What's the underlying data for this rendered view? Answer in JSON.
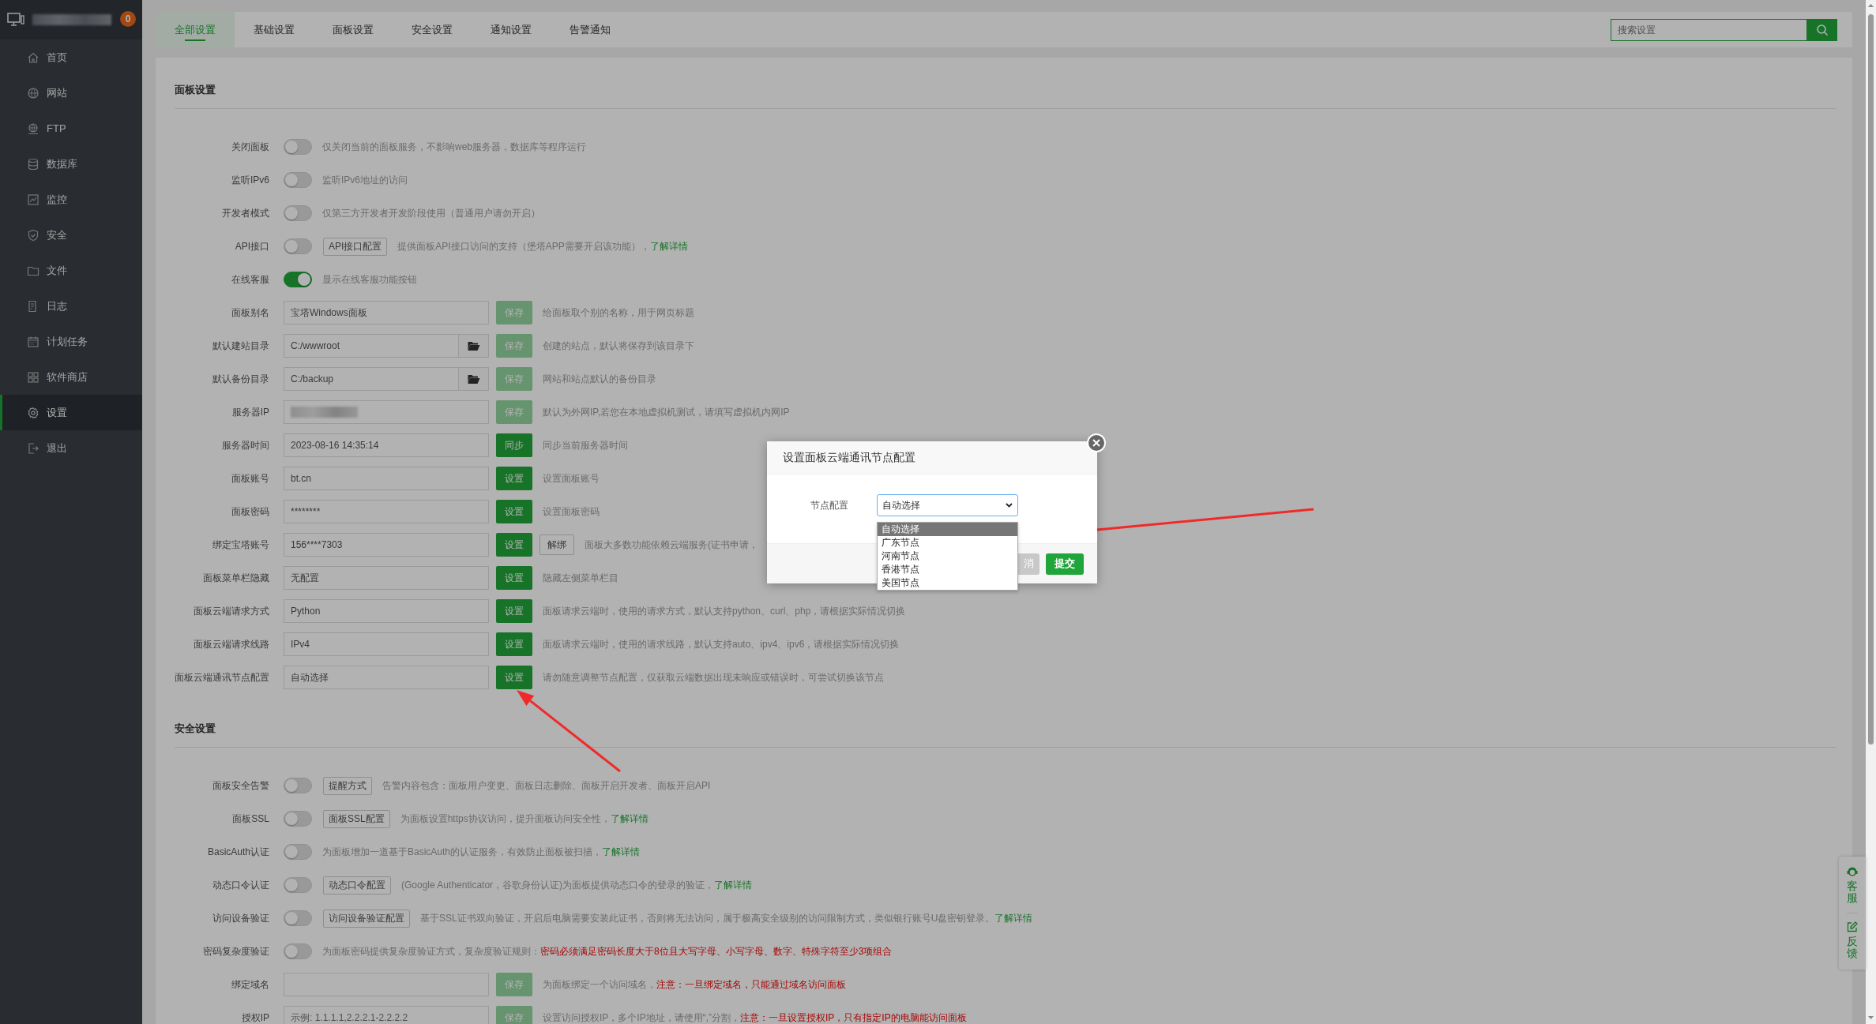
{
  "sidebar": {
    "title_redacted": true,
    "badge": "0",
    "items": [
      {
        "label": "首页",
        "selected": false
      },
      {
        "label": "网站",
        "selected": false
      },
      {
        "label": "FTP",
        "selected": false
      },
      {
        "label": "数据库",
        "selected": false
      },
      {
        "label": "监控",
        "selected": false
      },
      {
        "label": "安全",
        "selected": false
      },
      {
        "label": "文件",
        "selected": false
      },
      {
        "label": "日志",
        "selected": false
      },
      {
        "label": "计划任务",
        "selected": false
      },
      {
        "label": "软件商店",
        "selected": false
      },
      {
        "label": "设置",
        "selected": true
      },
      {
        "label": "退出",
        "selected": false
      }
    ]
  },
  "tabs": [
    {
      "label": "全部设置",
      "selected": true
    },
    {
      "label": "基础设置",
      "selected": false
    },
    {
      "label": "面板设置",
      "selected": false
    },
    {
      "label": "安全设置",
      "selected": false
    },
    {
      "label": "通知设置",
      "selected": false
    },
    {
      "label": "告警通知",
      "selected": false
    }
  ],
  "search": {
    "placeholder": "搜索设置"
  },
  "sections": [
    {
      "title": "面板设置",
      "rows": [
        {
          "kind": "toggle",
          "label": "关闭面板",
          "on": false,
          "description": [
            {
              "kind": "text",
              "text": "仅关闭当前的面板服务，不影响web服务器，数据库等程序运行"
            }
          ]
        },
        {
          "kind": "toggle",
          "label": "监听IPv6",
          "on": false,
          "description": [
            {
              "kind": "text",
              "text": "监听IPv6地址的访问"
            }
          ]
        },
        {
          "kind": "toggle",
          "label": "开发者模式",
          "on": false,
          "description": [
            {
              "kind": "text",
              "text": "仅第三方开发者开发阶段使用（普通用户请勿开启）"
            }
          ]
        },
        {
          "kind": "toggle",
          "label": "API接口",
          "on": false,
          "button": "API接口配置",
          "description": [
            {
              "kind": "text",
              "text": "提供面板API接口访问的支持（堡塔APP需要开启该功能），"
            },
            {
              "kind": "link",
              "text": "了解详情"
            }
          ]
        },
        {
          "kind": "toggle",
          "label": "在线客服",
          "on": true,
          "description": [
            {
              "kind": "text",
              "text": "显示在线客服功能按钮"
            }
          ]
        },
        {
          "kind": "input",
          "label": "面板别名",
          "value": "宝塔Windows面板",
          "action": {
            "label": "保存",
            "disabled": true
          },
          "description": [
            {
              "kind": "text",
              "text": "给面板取个别的名称，用于网页标题"
            }
          ]
        },
        {
          "kind": "input",
          "label": "默认建站目录",
          "value": "C:/wwwroot",
          "folder": true,
          "action": {
            "label": "保存",
            "disabled": true
          },
          "description": [
            {
              "kind": "text",
              "text": "创建的站点，默认将保存到该目录下"
            }
          ]
        },
        {
          "kind": "input",
          "label": "默认备份目录",
          "value": "C:/backup",
          "folder": true,
          "action": {
            "label": "保存",
            "disabled": true
          },
          "description": [
            {
              "kind": "text",
              "text": "网站和站点默认的备份目录"
            }
          ]
        },
        {
          "kind": "input",
          "label": "服务器IP",
          "redacted": true,
          "action": {
            "label": "保存",
            "disabled": true
          },
          "description": [
            {
              "kind": "text",
              "text": "默认为外网IP,若您在本地虚拟机测试，请填写虚拟机内网IP"
            }
          ]
        },
        {
          "kind": "input",
          "label": "服务器时间",
          "value": "2023-08-16 14:35:14",
          "action": {
            "label": "同步",
            "disabled": false
          },
          "description": [
            {
              "kind": "text",
              "text": "同步当前服务器时间"
            }
          ]
        },
        {
          "kind": "input",
          "label": "面板账号",
          "value": "bt.cn",
          "action": {
            "label": "设置",
            "disabled": false
          },
          "description": [
            {
              "kind": "text",
              "text": "设置面板账号"
            }
          ]
        },
        {
          "kind": "input",
          "label": "面板密码",
          "value": "********",
          "action": {
            "label": "设置",
            "disabled": false
          },
          "description": [
            {
              "kind": "text",
              "text": "设置面板密码"
            }
          ]
        },
        {
          "kind": "input",
          "label": "绑定宝塔账号",
          "value": "156****7303",
          "action": {
            "label": "设置",
            "disabled": false
          },
          "extra_button": "解绑",
          "description": [
            {
              "kind": "text",
              "text": "面板大多数功能依赖云端服务(证书申请，"
            }
          ]
        },
        {
          "kind": "input",
          "label": "面板菜单栏隐藏",
          "value": "无配置",
          "action": {
            "label": "设置",
            "disabled": false
          },
          "description": [
            {
              "kind": "text",
              "text": "隐藏左侧菜单栏目"
            }
          ]
        },
        {
          "kind": "input",
          "label": "面板云端请求方式",
          "value": "Python",
          "action": {
            "label": "设置",
            "disabled": false
          },
          "description": [
            {
              "kind": "text",
              "text": "面板请求云端时，使用的请求方式，默认支持python、curl、php，请根据实际情况切换"
            }
          ]
        },
        {
          "kind": "input",
          "label": "面板云端请求线路",
          "value": "IPv4",
          "action": {
            "label": "设置",
            "disabled": false
          },
          "description": [
            {
              "kind": "text",
              "text": "面板请求云端时，使用的请求线路，默认支持auto、ipv4、ipv6，请根据实际情况切换"
            }
          ]
        },
        {
          "kind": "input",
          "label": "面板云端通讯节点配置",
          "value": "自动选择",
          "action": {
            "label": "设置",
            "disabled": false
          },
          "description": [
            {
              "kind": "text",
              "text": "请勿随意调整节点配置，仅获取云端数据出现未响应或错误时，可尝试切换该节点"
            }
          ]
        }
      ]
    },
    {
      "title": "安全设置",
      "rows": [
        {
          "kind": "toggle",
          "label": "面板安全告警",
          "on": false,
          "button": "提醒方式",
          "description": [
            {
              "kind": "text",
              "text": "告警内容包含：面板用户变更、面板日志删除、面板开启开发者、面板开启API"
            }
          ]
        },
        {
          "kind": "toggle",
          "label": "面板SSL",
          "on": false,
          "button": "面板SSL配置",
          "description": [
            {
              "kind": "text",
              "text": "为面板设置https协议访问，提升面板访问安全性，"
            },
            {
              "kind": "link",
              "text": "了解详情"
            }
          ]
        },
        {
          "kind": "toggle",
          "label": "BasicAuth认证",
          "on": false,
          "description": [
            {
              "kind": "text",
              "text": "为面板增加一道基于BasicAuth的认证服务，有效防止面板被扫描，"
            },
            {
              "kind": "link",
              "text": "了解详情"
            }
          ]
        },
        {
          "kind": "toggle",
          "label": "动态口令认证",
          "on": false,
          "button": "动态口令配置",
          "description": [
            {
              "kind": "text",
              "text": "(Google Authenticator，谷歌身份认证)为面板提供动态口令的登录的验证，"
            },
            {
              "kind": "link",
              "text": "了解详情"
            }
          ]
        },
        {
          "kind": "toggle",
          "label": "访问设备验证",
          "on": false,
          "button": "访问设备验证配置",
          "description": [
            {
              "kind": "text",
              "text": "基于SSL证书双向验证，开启后电脑需要安装此证书，否则将无法访问，属于极高安全级别的访问限制方式，类似银行账号U盘密钥登录。"
            },
            {
              "kind": "link",
              "text": "了解详情"
            }
          ]
        },
        {
          "kind": "toggle",
          "label": "密码复杂度验证",
          "on": false,
          "description": [
            {
              "kind": "text",
              "text": "为面板密码提供复杂度验证方式，复杂度验证规则："
            },
            {
              "kind": "warning",
              "text": "密码必须满足密码长度大于8位且大写字母、小写字母、数字、特殊字符至少3项组合"
            }
          ]
        },
        {
          "kind": "input",
          "label": "绑定域名",
          "action": {
            "label": "保存",
            "disabled": true
          },
          "description": [
            {
              "kind": "text",
              "text": "为面板绑定一个访问域名，"
            },
            {
              "kind": "warning",
              "text": "注意：一旦绑定域名，只能通过域名访问面板"
            }
          ]
        },
        {
          "kind": "input",
          "label": "授权IP",
          "placeholder": "示例: 1.1.1.1,2.2.2.1-2.2.2.2",
          "action": {
            "label": "保存",
            "disabled": true
          },
          "description": [
            {
              "kind": "text",
              "text": "设置访问授权IP，多个IP地址，请使用“,”分割，"
            },
            {
              "kind": "warning",
              "text": "注意：一旦设置授权IP，只有指定IP的电脑能访问面板"
            }
          ]
        }
      ]
    }
  ],
  "float_panel": {
    "items": [
      {
        "label": "客服"
      },
      {
        "label": "反馈"
      }
    ]
  },
  "dialog": {
    "title": "设置面板云端通讯节点配置",
    "field_label": "节点配置",
    "select": {
      "value": "自动选择",
      "options": [
        {
          "label": "自动选择",
          "selected": true
        },
        {
          "label": "广东节点",
          "selected": false
        },
        {
          "label": "河南节点",
          "selected": false
        },
        {
          "label": "香港节点",
          "selected": false
        },
        {
          "label": "美国节点",
          "selected": false
        }
      ]
    },
    "buttons": [
      {
        "kind": "cancel",
        "label": "消"
      },
      {
        "kind": "primary",
        "label": "提交"
      }
    ]
  }
}
